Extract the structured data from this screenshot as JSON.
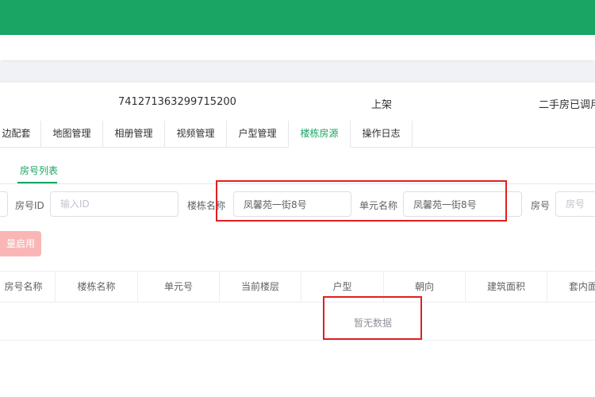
{
  "info": {
    "id": "741271363299715200",
    "status": "上架",
    "note": "二手房已调用"
  },
  "tabs": [
    {
      "label": "边配套"
    },
    {
      "label": "地图管理"
    },
    {
      "label": "相册管理"
    },
    {
      "label": "视频管理"
    },
    {
      "label": "户型管理"
    },
    {
      "label": "楼栋房源"
    },
    {
      "label": "操作日志"
    }
  ],
  "active_tab": "楼栋房源",
  "subtab": {
    "label": "房号列表"
  },
  "filters": {
    "room_id": {
      "label": "房号ID",
      "placeholder": "输入ID"
    },
    "building": {
      "label": "楼栋名称",
      "value": "凤馨苑一街8号"
    },
    "unit": {
      "label": "单元名称",
      "value": "凤馨苑一街8号"
    },
    "room": {
      "label": "房号",
      "placeholder": "房号"
    }
  },
  "buttons": {
    "batch_enable": "量启用"
  },
  "table": {
    "columns": [
      "房号名称",
      "楼栋名称",
      "单元号",
      "当前楼层",
      "户型",
      "朝向",
      "建筑面积",
      "套内面"
    ],
    "empty_text": "暂无数据"
  },
  "colors": {
    "brand": "#1aa564",
    "highlight": "#e02020",
    "disabled_danger": "#fab6b6"
  }
}
